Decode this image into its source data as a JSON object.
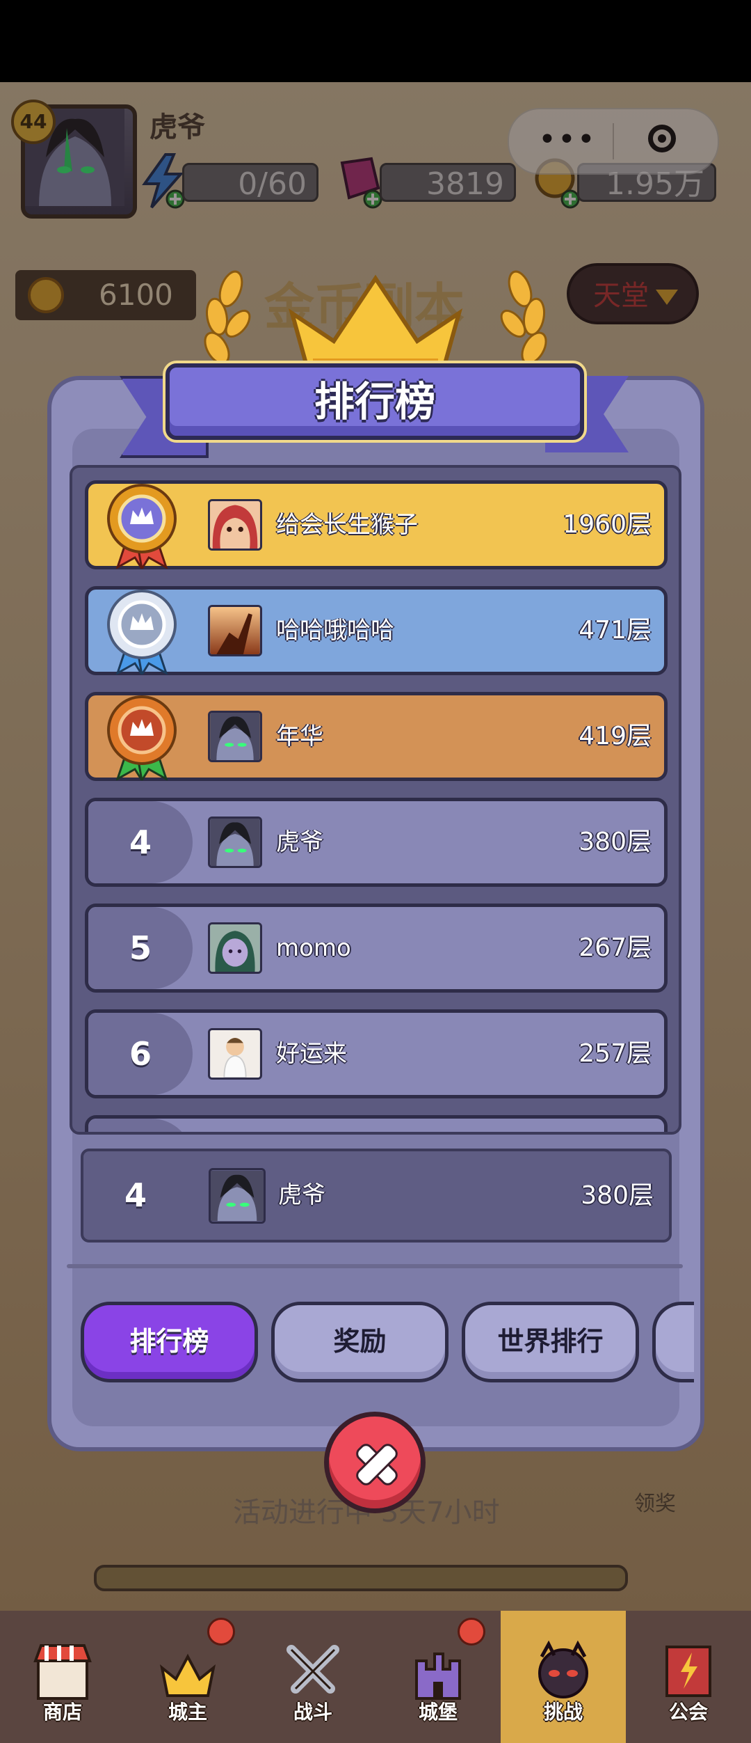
{
  "player": {
    "name": "虎爷",
    "level": "44"
  },
  "resources": {
    "energy": "0/60",
    "gems": "3819",
    "coins": "1.95万"
  },
  "background": {
    "coin_count": "6100",
    "title": "金币副本",
    "difficulty": "天堂",
    "event_text": "活动进行中 3天7小时",
    "claim_label": "领奖"
  },
  "modal": {
    "title": "排行榜",
    "rows": [
      {
        "rank": "1",
        "name": "给会长生猴子",
        "floor": "1960层"
      },
      {
        "rank": "2",
        "name": "哈哈哦哈哈",
        "floor": "471层"
      },
      {
        "rank": "3",
        "name": "年华",
        "floor": "419层"
      },
      {
        "rank": "4",
        "name": "虎爷",
        "floor": "380层"
      },
      {
        "rank": "5",
        "name": "momo",
        "floor": "267层"
      },
      {
        "rank": "6",
        "name": "好运来",
        "floor": "257层"
      }
    ],
    "self_row": {
      "rank": "4",
      "name": "虎爷",
      "floor": "380层"
    },
    "tabs": [
      {
        "label": "排行榜",
        "active": true
      },
      {
        "label": "奖励",
        "active": false
      },
      {
        "label": "世界排行",
        "active": false
      }
    ]
  },
  "nav": [
    {
      "label": "商店",
      "icon": "shop-icon"
    },
    {
      "label": "城主",
      "icon": "crown-icon"
    },
    {
      "label": "战斗",
      "icon": "swords-icon"
    },
    {
      "label": "城堡",
      "icon": "castle-icon"
    },
    {
      "label": "挑战",
      "icon": "demon-icon"
    },
    {
      "label": "公会",
      "icon": "banner-icon"
    }
  ],
  "colors": {
    "gold_row": "#f2c451",
    "silver_row": "#7fa6dc",
    "bronze_row": "#d39256",
    "normal_row": "#8988b6",
    "tab_active": "#8a44e6"
  }
}
